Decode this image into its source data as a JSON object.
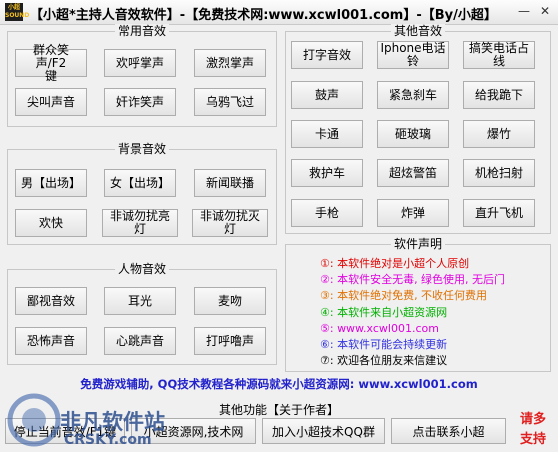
{
  "titlebar": {
    "app_icon_text": "小超\nSOUND",
    "title": "【小超*主持人音效软件】-【免费技术网:www.xcwl001.com】-【By/小超】",
    "minimize": "—",
    "close": "✕"
  },
  "groups": {
    "common": {
      "label": "常用音效",
      "buttons": [
        "群众笑声/F2\n键",
        "欢呼掌声",
        "激烈掌声",
        "尖叫声音",
        "奸诈笑声",
        "乌鸦飞过"
      ]
    },
    "background": {
      "label": "背景音效",
      "buttons": [
        "男【出场】",
        "女【出场】",
        "新闻联播",
        "欢快",
        "非诚勿扰亮灯",
        "非诚勿扰灭灯"
      ]
    },
    "character": {
      "label": "人物音效",
      "buttons": [
        "鄙视音效",
        "耳光",
        "麦吻",
        "恐怖声音",
        "心跳声音",
        "打呼噜声"
      ]
    },
    "other": {
      "label": "其他音效",
      "buttons": [
        "打字音效",
        "Iphone电话铃",
        "搞笑电话占线",
        "鼓声",
        "紧急刹车",
        "给我跪下",
        "卡通",
        "砸玻璃",
        "爆竹",
        "救护车",
        "超炫警笛",
        "机枪扫射",
        "手枪",
        "炸弹",
        "直升飞机"
      ]
    },
    "declaration": {
      "label": "软件声明",
      "lines": [
        {
          "text": "①: 本软件绝对是小超个人原创",
          "color": "#e00000"
        },
        {
          "text": "②: 本软件安全无毒, 绿色使用, 无后门",
          "color": "#e000e0"
        },
        {
          "text": "③: 本软件绝对免费, 不收任何费用",
          "color": "#e07000"
        },
        {
          "text": "④: 本软件来自小超资源网",
          "color": "#00b000"
        },
        {
          "text": "⑤: www.xcwl001.com",
          "color": "#e000e0"
        },
        {
          "text": "⑥: 本软件可能会持续更新",
          "color": "#3030e0"
        },
        {
          "text": "⑦: 欢迎各位朋友来信建议",
          "color": "#000000"
        }
      ]
    }
  },
  "promo": "免费游戏辅助, QQ技术教程各种源码就来小超资源网: www.xcwl001.com",
  "bottom": {
    "label": "其他功能【关于作者】",
    "buttons": [
      "停止当前音效/F1键",
      "小超资源网,技术网",
      "加入小超技术QQ群",
      "点击联系小超"
    ],
    "support": "请多\n支持"
  },
  "watermark": {
    "text": "非凡软件站",
    "sub": "CRSKY.com"
  }
}
